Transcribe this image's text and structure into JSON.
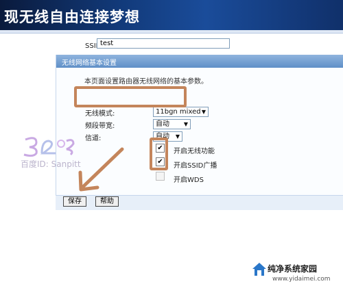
{
  "header": {
    "title": "现无线自由连接梦想"
  },
  "panel": {
    "title": "无线网络基本设置",
    "description": "本页面设置路由器无线网络的基本参数。"
  },
  "form": {
    "ssid": {
      "label": "SSID号:",
      "value": "test"
    },
    "mode": {
      "label": "无线模式:",
      "value": "11bgn mixed"
    },
    "bandwidth": {
      "label": "频段带宽:",
      "value": "自动"
    },
    "channel": {
      "label": "信道:",
      "value": "自动"
    },
    "enable_wireless": {
      "label": "开启无线功能",
      "checked": true
    },
    "enable_ssid_broadcast": {
      "label": "开启SSID广播",
      "checked": true
    },
    "enable_wds": {
      "label": "开启WDS",
      "checked": false
    }
  },
  "buttons": {
    "save": "保存",
    "help": "帮助"
  },
  "watermark": {
    "id_text": "百度ID: Sanpitt"
  },
  "footer": {
    "brand": "纯净系统家园",
    "url": "www.yidaimei.com"
  },
  "colors": {
    "accent_highlight": "#c4855b",
    "panel_header": "#6f9bcf"
  },
  "icons": {
    "dropdown": "chevron-down-icon",
    "checkbox_checked": "check-icon",
    "footer_logo": "house-icon"
  }
}
